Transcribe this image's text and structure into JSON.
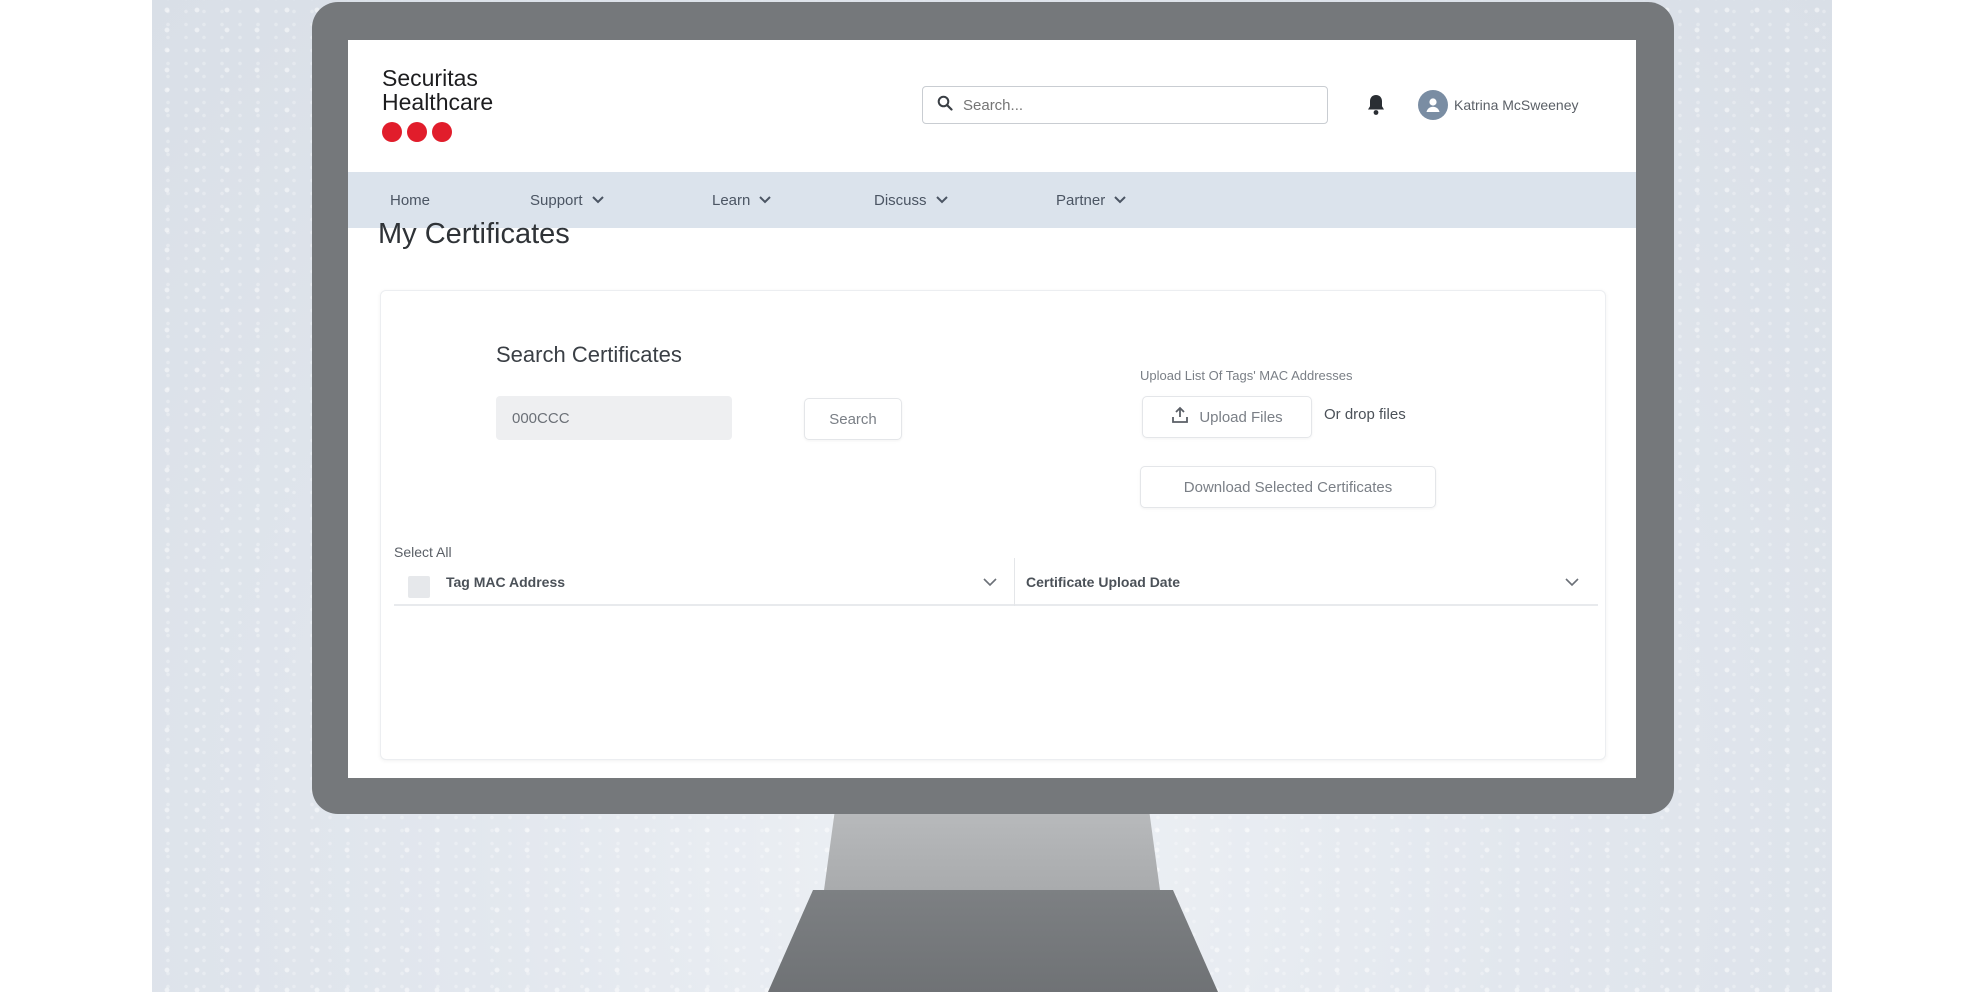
{
  "brand": {
    "line1": "Securitas",
    "line2": "Healthcare",
    "accent": "#e11d2b"
  },
  "header": {
    "search_placeholder": "Search...",
    "bell_icon": "bell-icon",
    "user_name": "Katrina McSweeney",
    "avatar_icon": "user-avatar-icon"
  },
  "nav": {
    "items": [
      {
        "label": "Home"
      },
      {
        "label": "Support"
      },
      {
        "label": "Learn"
      },
      {
        "label": "Discuss"
      },
      {
        "label": "Partner"
      }
    ]
  },
  "page": {
    "title": "My Certificates"
  },
  "search_certificates": {
    "title": "Search Certificates",
    "input_value": "000CCC",
    "search_button": "Search"
  },
  "upload": {
    "label": "Upload List Of Tags' MAC Addresses",
    "upload_button": "Upload Files",
    "drop_text": "Or drop files",
    "download_button": "Download Selected Certificates"
  },
  "table": {
    "select_all": "Select All",
    "columns": [
      {
        "label": "Tag MAC Address"
      },
      {
        "label": "Certificate Upload Date"
      }
    ]
  },
  "colors": {
    "nav_bg": "#dbe3ec",
    "bezel": "#75787b"
  }
}
